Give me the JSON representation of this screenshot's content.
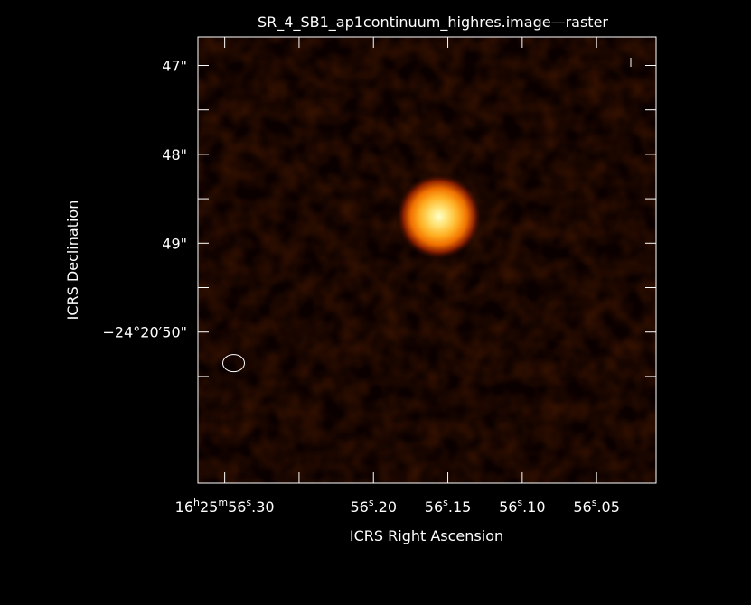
{
  "chart_data": {
    "type": "heatmap",
    "title": "SR_4_SB1_ap1continuum_highres.image—raster",
    "xlabel": "ICRS Right Ascension",
    "ylabel": "ICRS Declination",
    "x_unit": "RA seconds (16h25m)",
    "y_unit": "Dec arcsec (-24d20m)",
    "xlim": [
      56.318,
      56.01
    ],
    "ylim": [
      51.7,
      46.68
    ],
    "x_ticks": [
      {
        "value": 56.3,
        "label_main": "16",
        "sup1": "h",
        "label_mid": "25",
        "sup2": "m",
        "label_end": "56",
        "sup3": "s",
        "label_tail": ".30"
      },
      {
        "value": 56.2,
        "label_main": "",
        "sup1": "",
        "label_mid": "",
        "sup2": "",
        "label_end": "56",
        "sup3": "s",
        "label_tail": ".20"
      },
      {
        "value": 56.15,
        "label_main": "",
        "sup1": "",
        "label_mid": "",
        "sup2": "",
        "label_end": "56",
        "sup3": "s",
        "label_tail": ".15"
      },
      {
        "value": 56.1,
        "label_main": "",
        "sup1": "",
        "label_mid": "",
        "sup2": "",
        "label_end": "56",
        "sup3": "s",
        "label_tail": ".10"
      },
      {
        "value": 56.05,
        "label_main": "",
        "sup1": "",
        "label_mid": "",
        "sup2": "",
        "label_end": "56",
        "sup3": "s",
        "label_tail": ".05"
      }
    ],
    "x_minor_ticks": [
      56.25
    ],
    "y_ticks": [
      {
        "value": 47,
        "label": "47\""
      },
      {
        "value": 48,
        "label": "48\""
      },
      {
        "value": 49,
        "label": "49\""
      },
      {
        "value": 50,
        "label": "−24°20′50\""
      }
    ],
    "y_minor_ticks": [
      47.5,
      48.5,
      49.5,
      50.5
    ],
    "source": {
      "ra_s": 56.156,
      "dec_s": 48.7,
      "colormap": "hot"
    },
    "beam": {
      "ra_s": 56.294,
      "dec_s": 50.35
    },
    "grid": false,
    "legend": "none"
  }
}
